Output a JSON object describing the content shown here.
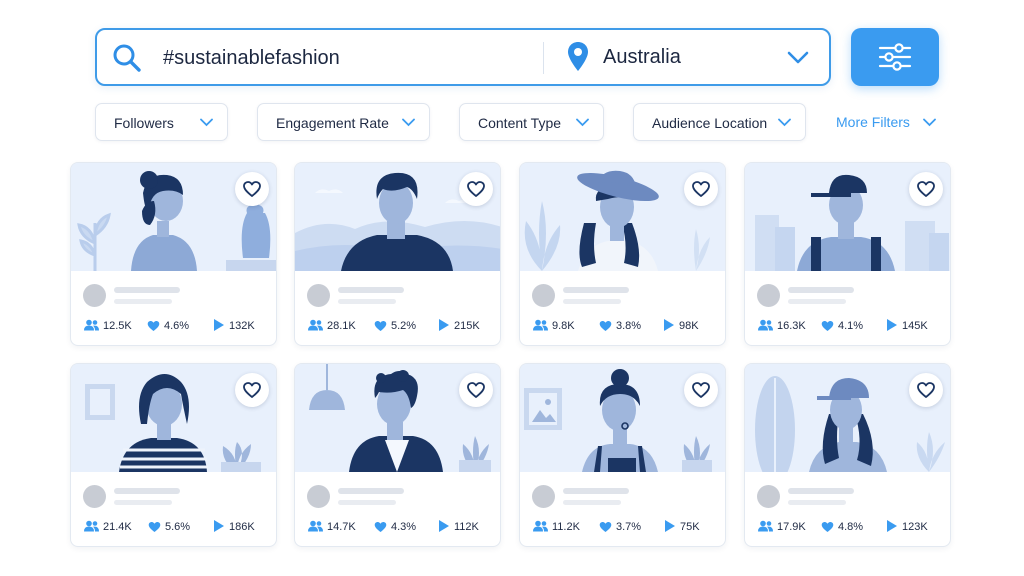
{
  "search": {
    "query": "#sustainablefashion",
    "location": "Australia"
  },
  "colors": {
    "accent": "#3a9bf0",
    "navy": "#1b3563",
    "figure": "#9fb6dc",
    "bg_tint": "#e8f0fc"
  },
  "icons": {
    "search": "search-icon",
    "location": "map-pin-icon",
    "dropdown": "chevron-down-icon",
    "filter": "sliders-icon",
    "favorite": "heart-outline-icon",
    "followers": "users-icon",
    "engagement": "heart-icon",
    "views": "play-icon"
  },
  "filters": [
    {
      "label": "Followers"
    },
    {
      "label": "Engagement Rate"
    },
    {
      "label": "Content Type"
    },
    {
      "label": "Audience Location"
    }
  ],
  "more_filters": {
    "label": "More Filters"
  },
  "cards": [
    {
      "followers": "12.5K",
      "engagement": "4.6%",
      "views": "132K"
    },
    {
      "followers": "28.1K",
      "engagement": "5.2%",
      "views": "215K"
    },
    {
      "followers": "9.8K",
      "engagement": "3.8%",
      "views": "98K"
    },
    {
      "followers": "16.3K",
      "engagement": "4.1%",
      "views": "145K"
    },
    {
      "followers": "21.4K",
      "engagement": "5.6%",
      "views": "186K"
    },
    {
      "followers": "14.7K",
      "engagement": "4.3%",
      "views": "112K"
    },
    {
      "followers": "11.2K",
      "engagement": "3.7%",
      "views": "75K"
    },
    {
      "followers": "17.9K",
      "engagement": "4.8%",
      "views": "123K"
    }
  ]
}
